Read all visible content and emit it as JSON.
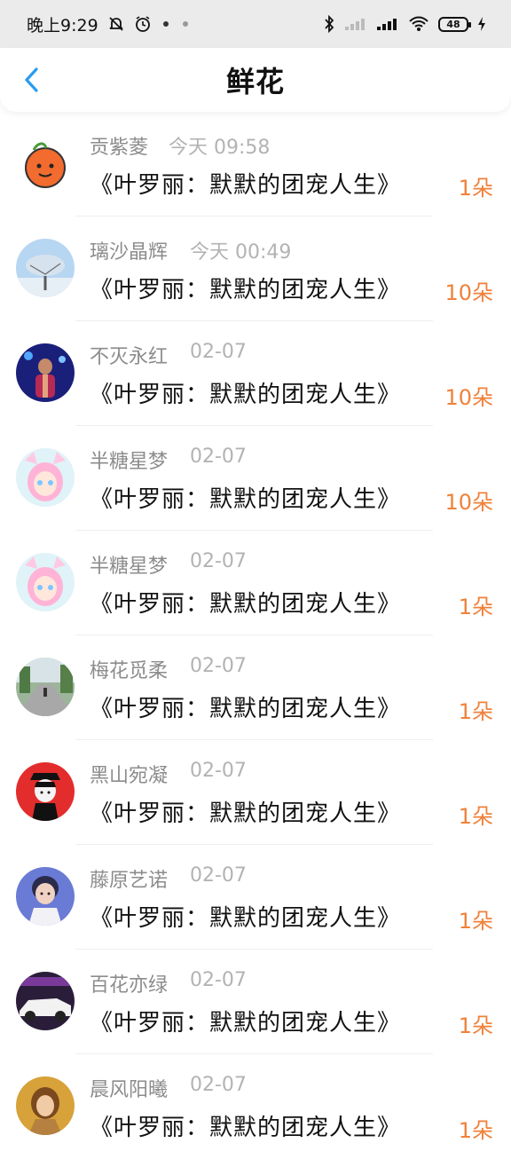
{
  "status_bar": {
    "time": "晚上9:29",
    "network_speed_icon": "signal-bars-icon",
    "battery": "48"
  },
  "header": {
    "title": "鲜花",
    "back_icon": "chevron-left-icon"
  },
  "colors": {
    "count_color": "#f0813a",
    "back_color": "#2a9bf0"
  },
  "items": [
    {
      "name": "贡紫菱",
      "time": "今天 09:58",
      "book": "《叶罗丽：默默的团宠人生》",
      "count": "1朵"
    },
    {
      "name": "璃沙晶辉",
      "time": "今天 00:49",
      "book": "《叶罗丽：默默的团宠人生》",
      "count": "10朵"
    },
    {
      "name": "不灭永红",
      "time": "02-07",
      "book": "《叶罗丽：默默的团宠人生》",
      "count": "10朵"
    },
    {
      "name": "半糖星梦",
      "time": "02-07",
      "book": "《叶罗丽：默默的团宠人生》",
      "count": "10朵"
    },
    {
      "name": "半糖星梦",
      "time": "02-07",
      "book": "《叶罗丽：默默的团宠人生》",
      "count": "1朵"
    },
    {
      "name": "梅花觅柔",
      "time": "02-07",
      "book": "《叶罗丽：默默的团宠人生》",
      "count": "1朵"
    },
    {
      "name": "黑山宛凝",
      "time": "02-07",
      "book": "《叶罗丽：默默的团宠人生》",
      "count": "1朵"
    },
    {
      "name": "藤原艺诺",
      "time": "02-07",
      "book": "《叶罗丽：默默的团宠人生》",
      "count": "1朵"
    },
    {
      "name": "百花亦绿",
      "time": "02-07",
      "book": "《叶罗丽：默默的团宠人生》",
      "count": "1朵"
    },
    {
      "name": "晨风阳曦",
      "time": "02-07",
      "book": "《叶罗丽：默默的团宠人生》",
      "count": "1朵"
    }
  ]
}
